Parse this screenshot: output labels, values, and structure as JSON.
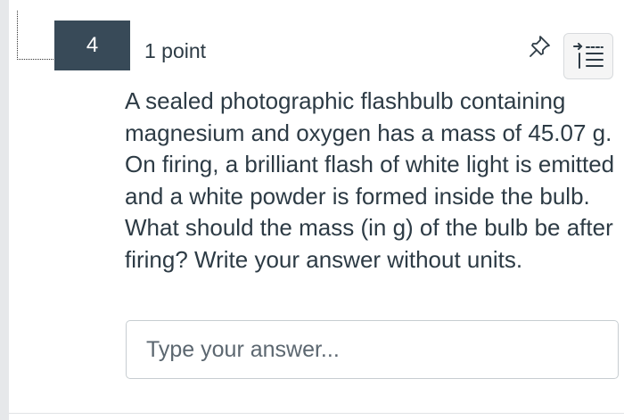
{
  "question": {
    "number": "4",
    "points": "1 point",
    "text": "A sealed photographic flashbulb containing magnesium and oxygen has a mass of 45.07 g. On firing, a brilliant flash of white light is emitted and a white powder is formed inside the bulb. What should the mass (in g) of the bulb be after firing? Write your answer without units."
  },
  "answer": {
    "value": "",
    "placeholder": "Type your answer..."
  },
  "icons": {
    "pin": "pushpin-icon",
    "toolbar": "reading-list-icon"
  },
  "colors": {
    "number_badge_bg": "#384a58",
    "text": "#2d3b45",
    "input_border": "#c7cdd1",
    "toolbar_bg": "#f5f5f5"
  }
}
